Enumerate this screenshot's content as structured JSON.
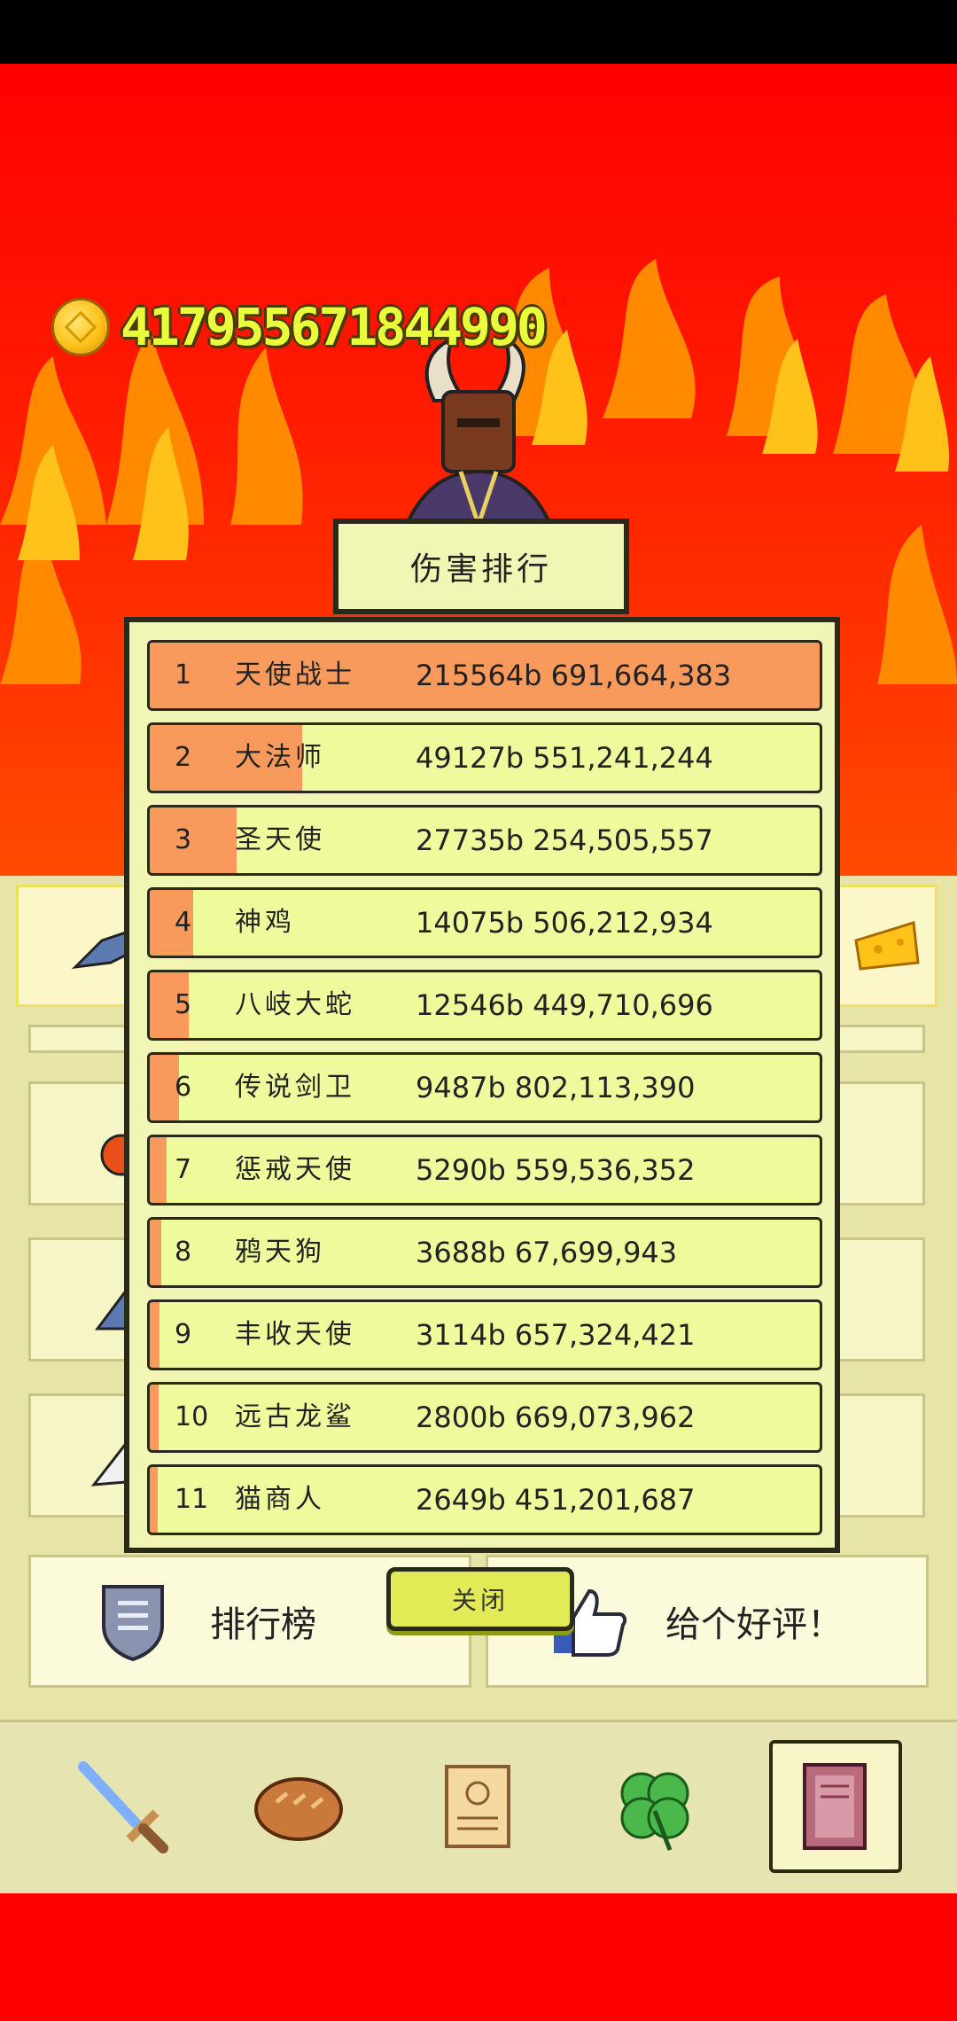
{
  "gold": "417955671844990",
  "popup": {
    "title": "伤害排行",
    "close_label": "关闭",
    "rows": [
      {
        "rank": "1",
        "name": "天使战士",
        "value": "215564b 691,664,383",
        "share": 1.0
      },
      {
        "rank": "2",
        "name": "大法师",
        "value": "49127b 551,241,244",
        "share": 0.228
      },
      {
        "rank": "3",
        "name": "圣天使",
        "value": "27735b 254,505,557",
        "share": 0.129
      },
      {
        "rank": "4",
        "name": "神鸡",
        "value": "14075b 506,212,934",
        "share": 0.065
      },
      {
        "rank": "5",
        "name": "八岐大蛇",
        "value": "12546b 449,710,696",
        "share": 0.058
      },
      {
        "rank": "6",
        "name": "传说剑卫",
        "value": "9487b 802,113,390",
        "share": 0.044
      },
      {
        "rank": "7",
        "name": "惩戒天使",
        "value": "5290b 559,536,352",
        "share": 0.025
      },
      {
        "rank": "8",
        "name": "鸦天狗",
        "value": "3688b 67,699,943",
        "share": 0.017
      },
      {
        "rank": "9",
        "name": "丰收天使",
        "value": "3114b 657,324,421",
        "share": 0.014
      },
      {
        "rank": "10",
        "name": "远古龙鲨",
        "value": "2800b 669,073,962",
        "share": 0.013
      },
      {
        "rank": "11",
        "name": "猫商人",
        "value": "2649b 451,201,687",
        "share": 0.012
      }
    ]
  },
  "buttons": {
    "leaderboard_label": "排行榜",
    "review_label": "给个好评！"
  },
  "nav": {
    "items": [
      "sword-icon",
      "bread-icon",
      "scroll-icon",
      "clover-icon",
      "book-icon"
    ],
    "selected": 4
  },
  "colors": {
    "bar_fill": "#f79a5c",
    "row_bg": "#eefa9c",
    "gold_text": "#e8ff3a"
  }
}
